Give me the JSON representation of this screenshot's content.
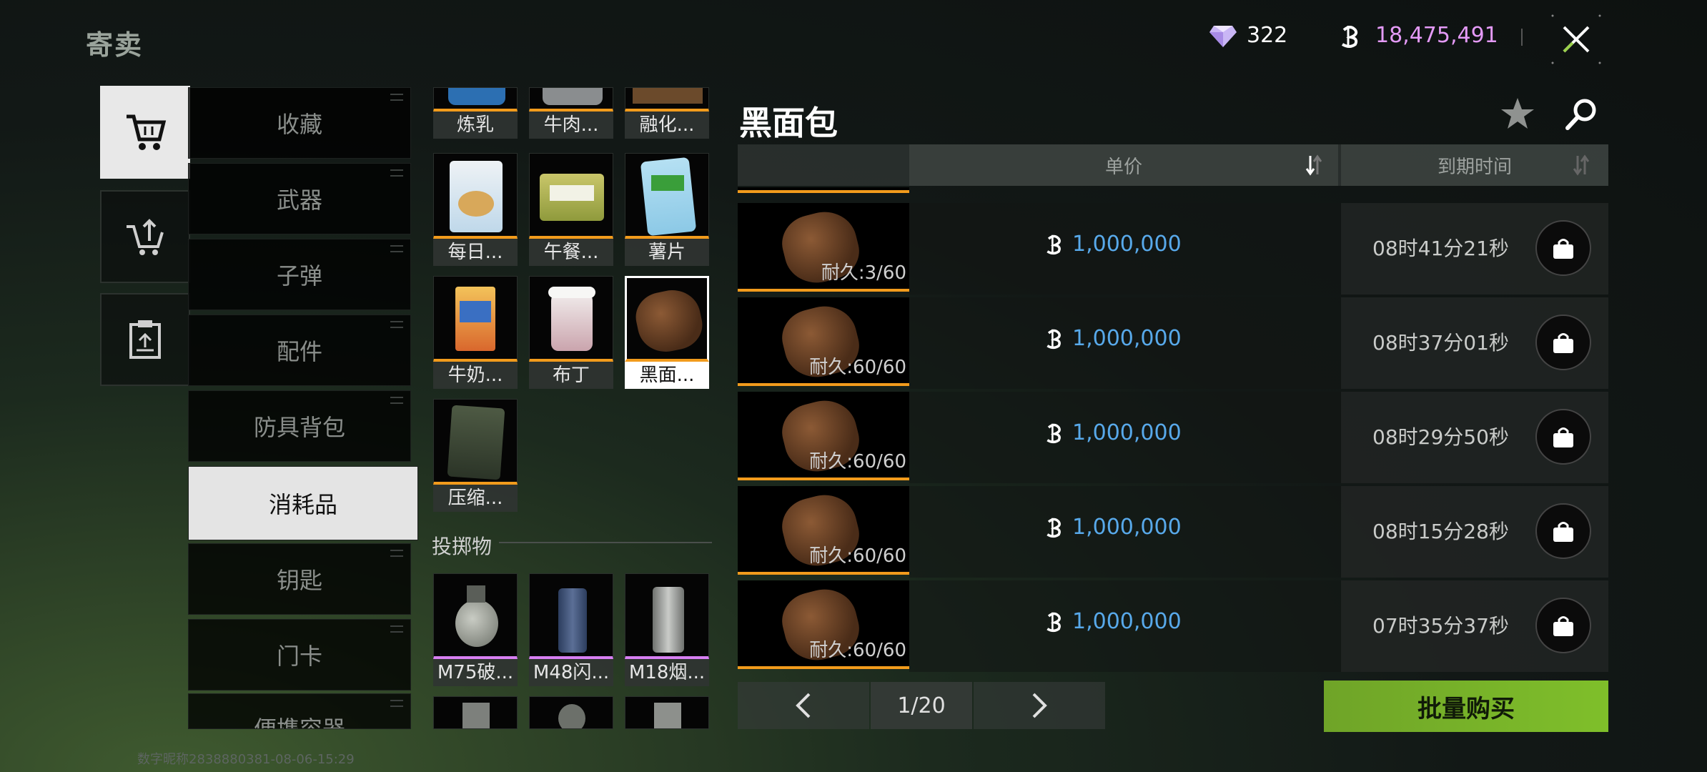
{
  "header": {
    "title": "寄卖",
    "gems": "322",
    "currency": "18,475,491",
    "gem_icon": "diamond-icon",
    "coin_icon": "coin-icon",
    "close_icon": "close-icon"
  },
  "nav": [
    {
      "icon": "cart-icon",
      "active": true
    },
    {
      "icon": "sell-cart-icon",
      "active": false
    },
    {
      "icon": "clipboard-icon",
      "active": false
    }
  ],
  "categories": [
    "收藏",
    "武器",
    "子弹",
    "配件",
    "防具背包",
    "消耗品",
    "钥匙",
    "门卡",
    "便携容器"
  ],
  "active_category": "消耗品",
  "items": [
    {
      "label": "炼乳"
    },
    {
      "label": "牛肉..."
    },
    {
      "label": "融化..."
    },
    {
      "label": "每日..."
    },
    {
      "label": "午餐..."
    },
    {
      "label": "薯片"
    },
    {
      "label": "牛奶..."
    },
    {
      "label": "布丁"
    },
    {
      "label": "黑面..."
    },
    {
      "label": "压缩..."
    }
  ],
  "throwables_section": "投掷物",
  "throwables": [
    {
      "label": "M75破..."
    },
    {
      "label": "M48闪..."
    },
    {
      "label": "M18烟..."
    }
  ],
  "detail": {
    "title": "黑面包",
    "col_price": "单价",
    "col_expire": "到期时间",
    "rows": [
      {
        "durability": "耐久:3/60",
        "price": "1,000,000",
        "time": "08时41分21秒"
      },
      {
        "durability": "耐久:60/60",
        "price": "1,000,000",
        "time": "08时37分01秒"
      },
      {
        "durability": "耐久:60/60",
        "price": "1,000,000",
        "time": "08时29分50秒"
      },
      {
        "durability": "耐久:60/60",
        "price": "1,000,000",
        "time": "08时15分28秒"
      },
      {
        "durability": "耐久:60/60",
        "price": "1,000,000",
        "time": "07时35分37秒"
      }
    ]
  },
  "pagination": {
    "page": "1/20"
  },
  "bulk_buy": "批量购买",
  "footer": "数字昵称2838880381-08-06-15:29",
  "colors": {
    "price": "#58a9ea",
    "currency": "#e49af7",
    "rarity_orange": "#f29b1c",
    "rarity_purple": "#d77ff2",
    "bulk": "#7fbf2a"
  }
}
